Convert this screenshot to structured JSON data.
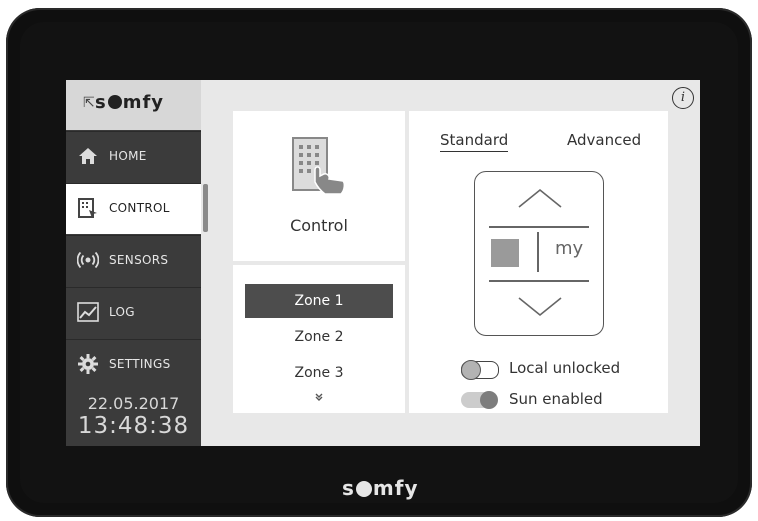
{
  "brand": {
    "logo_pre": "s",
    "logo_post": "mfy"
  },
  "sidebar": {
    "items": [
      {
        "label": "HOME",
        "icon": "home-icon"
      },
      {
        "label": "CONTROL",
        "icon": "control-icon"
      },
      {
        "label": "SENSORS",
        "icon": "sensors-icon"
      },
      {
        "label": "LOG",
        "icon": "log-icon"
      },
      {
        "label": "SETTINGS",
        "icon": "settings-icon"
      }
    ],
    "active": "CONTROL"
  },
  "clock": {
    "date": "22.05.2017",
    "time": "13:48:38"
  },
  "control_panel": {
    "title": "Control"
  },
  "zones": {
    "items": [
      "Zone 1",
      "Zone 2",
      "Zone 3"
    ],
    "selected": "Zone 1",
    "more": "»"
  },
  "tabs": {
    "standard": "Standard",
    "advanced": "Advanced",
    "active": "Standard"
  },
  "remote": {
    "my_label": "my"
  },
  "toggles": {
    "local": {
      "label": "Local unlocked",
      "state": "off"
    },
    "sun": {
      "label": "Sun enabled",
      "state": "on"
    }
  },
  "bezel": {
    "logo_pre": "s",
    "logo_post": "mfy"
  },
  "colors": {
    "sidebar_bg": "#3b3b3b",
    "active_item_bg": "#ffffff",
    "zone_selected_bg": "#4d4d4d",
    "bezel": "#0f0f0f"
  }
}
